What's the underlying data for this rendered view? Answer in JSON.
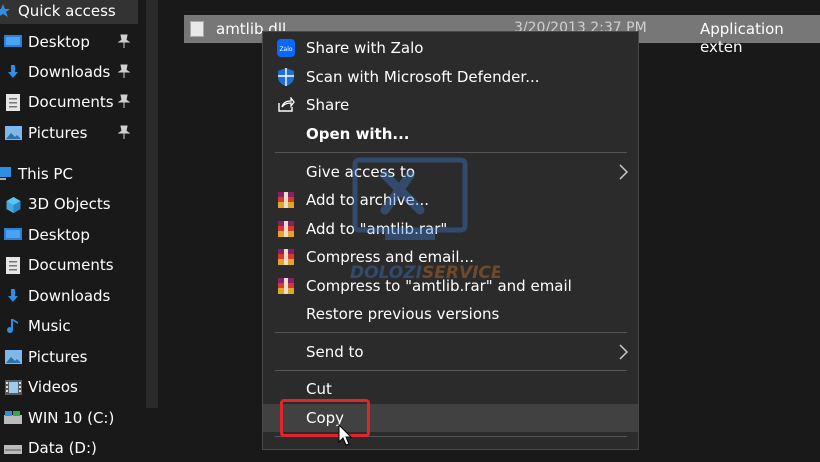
{
  "nav": {
    "items": [
      {
        "label": "Quick access",
        "icon": "star-icon",
        "pinned": false
      },
      {
        "label": "Desktop",
        "icon": "desktop-icon",
        "pinned": true
      },
      {
        "label": "Downloads",
        "icon": "download-icon",
        "pinned": true
      },
      {
        "label": "Documents",
        "icon": "document-icon",
        "pinned": true
      },
      {
        "label": "Pictures",
        "icon": "pictures-icon",
        "pinned": true
      },
      {
        "label": "This PC",
        "icon": "computer-icon",
        "pinned": false
      },
      {
        "label": "3D Objects",
        "icon": "cube-icon",
        "pinned": false
      },
      {
        "label": "Desktop",
        "icon": "desktop-icon",
        "pinned": false
      },
      {
        "label": "Documents",
        "icon": "document-icon",
        "pinned": false
      },
      {
        "label": "Downloads",
        "icon": "download-icon",
        "pinned": false
      },
      {
        "label": "Music",
        "icon": "music-icon",
        "pinned": false
      },
      {
        "label": "Pictures",
        "icon": "pictures-icon",
        "pinned": false
      },
      {
        "label": "Videos",
        "icon": "videos-icon",
        "pinned": false
      },
      {
        "label": "WIN 10 (C:)",
        "icon": "drive-icon",
        "pinned": false
      },
      {
        "label": "Data (D:)",
        "icon": "drive-icon",
        "pinned": false
      }
    ]
  },
  "file": {
    "name": "amtlib.dll",
    "date": "3/20/2013 2:37 PM",
    "type": "Application exten"
  },
  "menu": {
    "items": [
      {
        "label": "Share with Zalo",
        "icon": "zalo-icon"
      },
      {
        "label": "Scan with Microsoft Defender...",
        "icon": "defender-shield-icon"
      },
      {
        "label": "Share",
        "icon": "share-icon"
      },
      {
        "label": "Open with...",
        "bold": true
      },
      {
        "label": "Give access to",
        "submenu": true
      },
      {
        "label": "Add to archive...",
        "icon": "winrar-icon"
      },
      {
        "label": "Add to \"amtlib.rar\"",
        "icon": "winrar-icon"
      },
      {
        "label": "Compress and email...",
        "icon": "winrar-icon"
      },
      {
        "label": "Compress to \"amtlib.rar\" and email",
        "icon": "winrar-icon"
      },
      {
        "label": "Restore previous versions"
      },
      {
        "label": "Send to",
        "submenu": true
      },
      {
        "label": "Cut"
      },
      {
        "label": "Copy",
        "hovered": true
      }
    ]
  },
  "colors": {
    "highlight": "#e1252b",
    "menu_bg": "#2b2b2b",
    "selection": "#777777"
  }
}
